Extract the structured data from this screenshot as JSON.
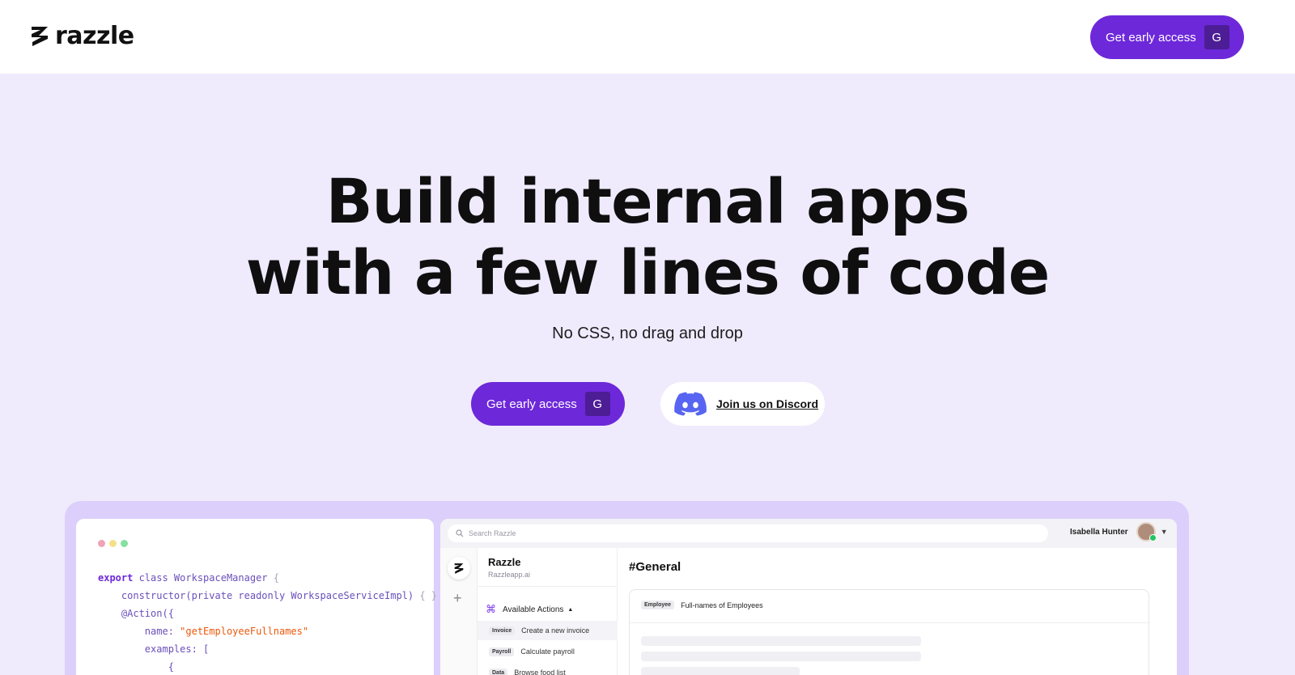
{
  "brand": {
    "name": "razzle"
  },
  "header": {
    "cta_label": "Get early access",
    "cta_key": "G"
  },
  "hero": {
    "headline_line1": "Build internal apps",
    "headline_line2": "with a few lines of code",
    "subhead": "No CSS, no drag and drop",
    "cta_label": "Get early access",
    "cta_key": "G",
    "discord_label": "Join us on Discord"
  },
  "colors": {
    "accent": "#6d28d9",
    "accent_dark": "#4c1d95",
    "hero_bg": "#efebfc",
    "preview_bg": "#dccffb"
  },
  "code_preview": {
    "line1_kw": "export",
    "line1_rest": " class WorkspaceManager ",
    "line1_brace": "{",
    "line2": "    constructor(private readonly WorkspaceServiceImpl) ",
    "line2_braces": "{ }",
    "line3": "    @Action({",
    "line4_key": "        name: ",
    "line4_val": "\"getEmployeeFullnames\"",
    "line5": "        examples: [",
    "line6": "            {"
  },
  "app_preview": {
    "search_placeholder": "Search Razzle",
    "user_name": "Isabella Hunter",
    "workspace_name": "Razzle",
    "workspace_url": "Razzleapp.ai",
    "actions_heading": "Available Actions",
    "actions": [
      {
        "tag": "Invoice",
        "label": "Create a new invoice"
      },
      {
        "tag": "Payroll",
        "label": "Calculate payroll"
      },
      {
        "tag": "Data",
        "label": "Browse food list"
      }
    ],
    "channel": "#General",
    "card_tag": "Employee",
    "card_title": "Full-names of Employees"
  }
}
